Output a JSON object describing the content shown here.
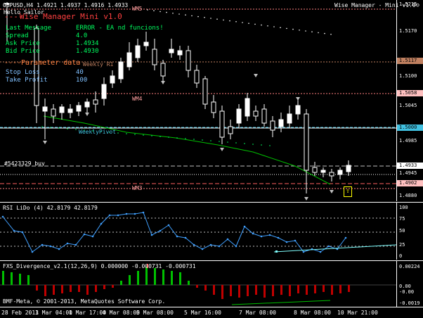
{
  "symbol_header": "GBPUSD,H4  1.4921 1.4937 1.4916 1.4933",
  "ea_title_right": "Wise Manager - Mini v1.0",
  "greeting": "Hello Sailor",
  "panel": {
    "title": "Wise Manager Mini v1.0",
    "divider": "----",
    "rows": [
      {
        "label": "Last Message",
        "value": "ERROR - EA nd funcions!"
      },
      {
        "label": "Spread",
        "value": "4.0"
      },
      {
        "label": "Ask Price",
        "value": "1.4934"
      },
      {
        "label": "Bid Price",
        "value": "1.4930"
      }
    ],
    "params_title": "Parameter data",
    "weekly_r1": "Weekly R1",
    "params": [
      {
        "label": "Stop Loss",
        "value": "40"
      },
      {
        "label": "Take Profit",
        "value": "100"
      }
    ]
  },
  "chart_labels": {
    "wm5": "WM5",
    "wm4": "WM4",
    "wm3": "WM3",
    "weekly_pivot": "WeeklyPivot",
    "order": "#5423329 buy"
  },
  "price_scale": {
    "ticks": [
      "1.5215",
      "1.5170",
      "1.5100",
      "1.5045",
      "1.4985",
      "1.4945",
      "1.4880"
    ],
    "badges": [
      {
        "text": "1.5117",
        "color": "#c08060"
      },
      {
        "text": "1.5058",
        "color": "#ffc0c0"
      },
      {
        "text": "1.5000",
        "color": "#40c0e0"
      },
      {
        "text": "1.4933",
        "color": "#ffffff"
      },
      {
        "text": "1.4902",
        "color": "#ffc0c0"
      }
    ]
  },
  "rsi": {
    "header": "RSI LiDo (4) 42.8179 42.8179",
    "ticks": [
      "100",
      "75",
      "50",
      "25",
      "0"
    ]
  },
  "fxs": {
    "header": "FXS_Divergence_v2.1(12,26,9) 0.000000 -0.000731 -0.000731",
    "ticks": [
      "0.00224",
      "0.00",
      "-0.00",
      "-0.0019"
    ],
    "copyright": "BMF-Meta, © 2001-2013, MetaQuotes Software Corp."
  },
  "time_axis": [
    "28 Feb 2013",
    "1 Mar 04:00",
    "1 Mar 17:00",
    "4 Mar 08:00",
    "5 Mar 08:00",
    "5 Mar 16:00",
    "7 Mar 08:00",
    "8 Mar 08:00",
    "10 Mar 21:00"
  ],
  "colors": {
    "background": "#000000",
    "bull_candle": "#ffffff",
    "bear_candle": "#000000",
    "panel_title": "#ff4040",
    "panel_label": "#00ff60",
    "panel_value": "#00ff60",
    "params_title": "#ff8040",
    "params_value": "#80c0ff",
    "pivot": "#40c0e0",
    "rsi_line": "#40a0ff",
    "hist_pos": "#00c000",
    "hist_neg": "#c00000",
    "arrow": "#ffff00"
  }
}
